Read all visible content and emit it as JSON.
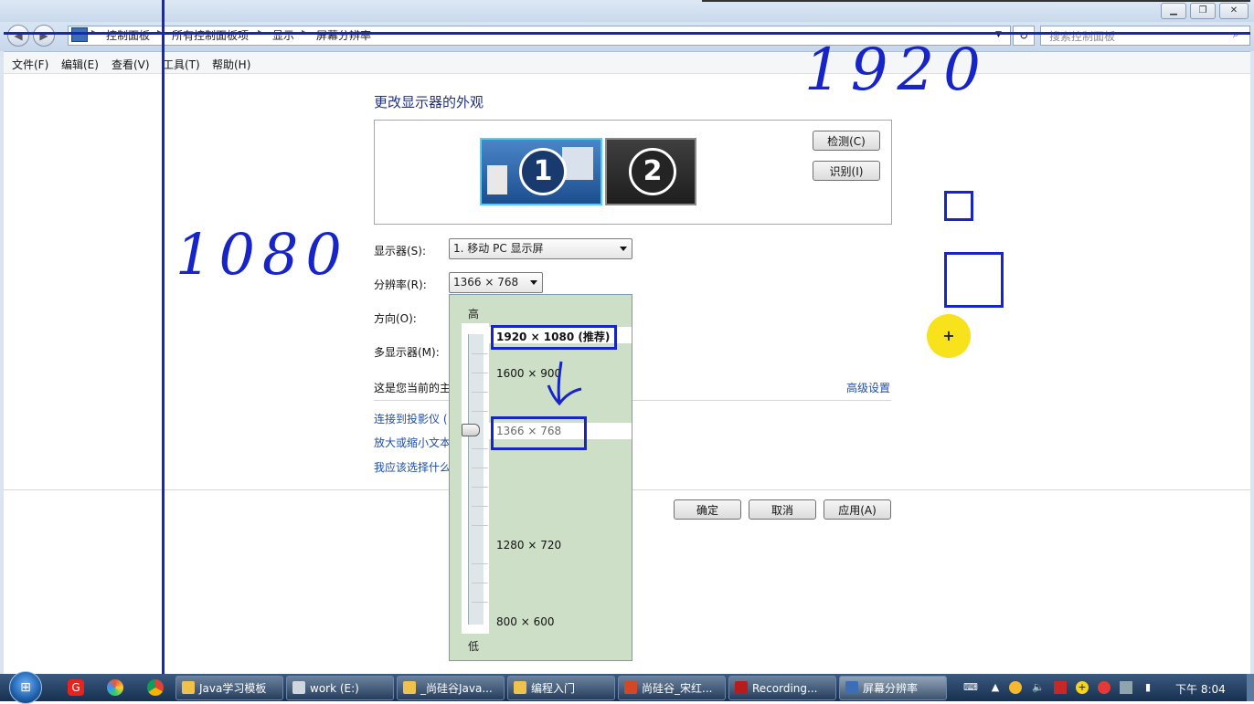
{
  "titlebar": {
    "minimize_icon": "minimize-icon",
    "maximize_icon": "maximize-icon",
    "close_icon": "close-icon"
  },
  "address": {
    "back_icon": "back-arrow-icon",
    "forward_icon": "forward-arrow-icon",
    "crumbs": [
      "控制面板",
      "所有控制面板项",
      "显示",
      "屏幕分辨率"
    ],
    "search_placeholder": "搜索控制面板"
  },
  "menubar": [
    "文件(F)",
    "编辑(E)",
    "查看(V)",
    "工具(T)",
    "帮助(H)"
  ],
  "page": {
    "title": "更改显示器的外观",
    "detect_button": "检测(C)",
    "identify_button": "识别(I)",
    "monitor1_number": "1",
    "monitor2_number": "2",
    "display_label": "显示器(S):",
    "display_value": "1. 移动 PC 显示屏",
    "resolution_label": "分辨率(R):",
    "resolution_value": "1366 × 768",
    "orientation_label": "方向(O):",
    "multi_display_label": "多显示器(M):",
    "current_text": "这是您当前的主",
    "advanced_link": "高级设置",
    "projector_link": "连接到投影仪 (",
    "text_size_link": "放大或缩小文本",
    "which_setting_link": "我应该选择什么",
    "ok_button": "确定",
    "cancel_button": "取消",
    "apply_button": "应用(A)"
  },
  "resolution_dropdown": {
    "high_label": "高",
    "low_label": "低",
    "options": [
      "1920 × 1080 (推荐)",
      "1600 × 900",
      "1366 × 768",
      "1280 × 720",
      "800 × 600"
    ],
    "selected": "1366 × 768"
  },
  "annotations": {
    "horizontal_number": "1920",
    "vertical_number": "1080",
    "cursor_symbol": "+"
  },
  "taskbar": {
    "start_icon": "windows-start-icon",
    "quick_launch": [
      "weibo-icon",
      "colorball-icon",
      "chrome-icon"
    ],
    "tasks": [
      "Java学习模板",
      "work (E:)",
      "_尚硅谷Java...",
      "编程入门",
      "尚硅谷_宋红...",
      "Recording...",
      "屏幕分辨率"
    ],
    "active_task": "屏幕分辨率",
    "tray_icons": [
      "keyboard-icon",
      "show-hidden-icon",
      "network-icon",
      "volume-icon",
      "red-app-icon",
      "yellow-app-icon",
      "record-icon",
      "device-icon",
      "power-icon"
    ],
    "clock": "下午 8:04"
  },
  "colors": {
    "pen_blue": "#1624c8",
    "cursor_yellow": "#f7e21b",
    "dropdown_bg": "#cde0c7",
    "taskbar": "#1f3a5f"
  }
}
